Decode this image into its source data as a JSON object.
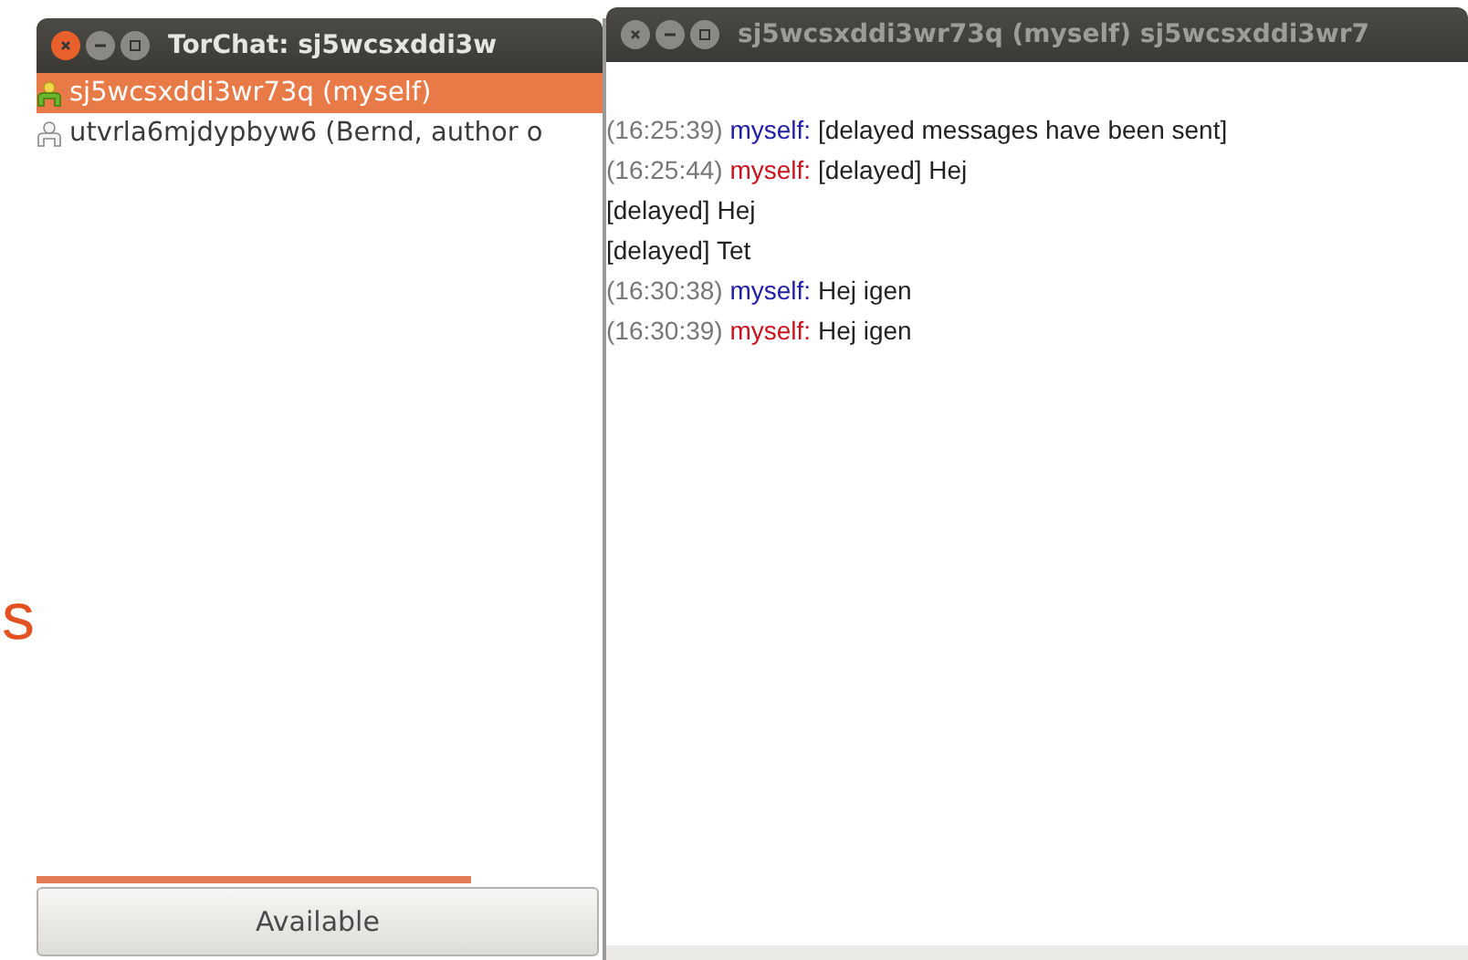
{
  "background_text": "s",
  "contact_window": {
    "title": "TorChat: sj5wcsxddi3w",
    "active": true,
    "contacts": [
      {
        "name": "sj5wcsxddi3wr73q (myself)",
        "kind": "online",
        "selected": true
      },
      {
        "name": "utvrla6mjdypbyw6 (Bernd, author o",
        "kind": "offline",
        "selected": false
      }
    ],
    "status_button": "Available"
  },
  "chat_window": {
    "title": "sj5wcsxddi3wr73q (myself) sj5wcsxddi3wr7",
    "active": false,
    "messages": [
      {
        "time": "(16:25:39)",
        "sender": "myself:",
        "color": "#2020a8",
        "text": "[delayed messages have been sent]"
      },
      {
        "time": "(16:25:44)",
        "sender": "myself:",
        "color": "#c8141e",
        "text": "[delayed] Hej"
      },
      {
        "text": "[delayed] Hej"
      },
      {
        "text": "[delayed] Tet"
      },
      {
        "time": "(16:30:38)",
        "sender": "myself:",
        "color": "#2020a8",
        "text": "Hej igen"
      },
      {
        "time": "(16:30:39)",
        "sender": "myself:",
        "color": "#c8141e",
        "text": "Hej igen"
      }
    ]
  }
}
